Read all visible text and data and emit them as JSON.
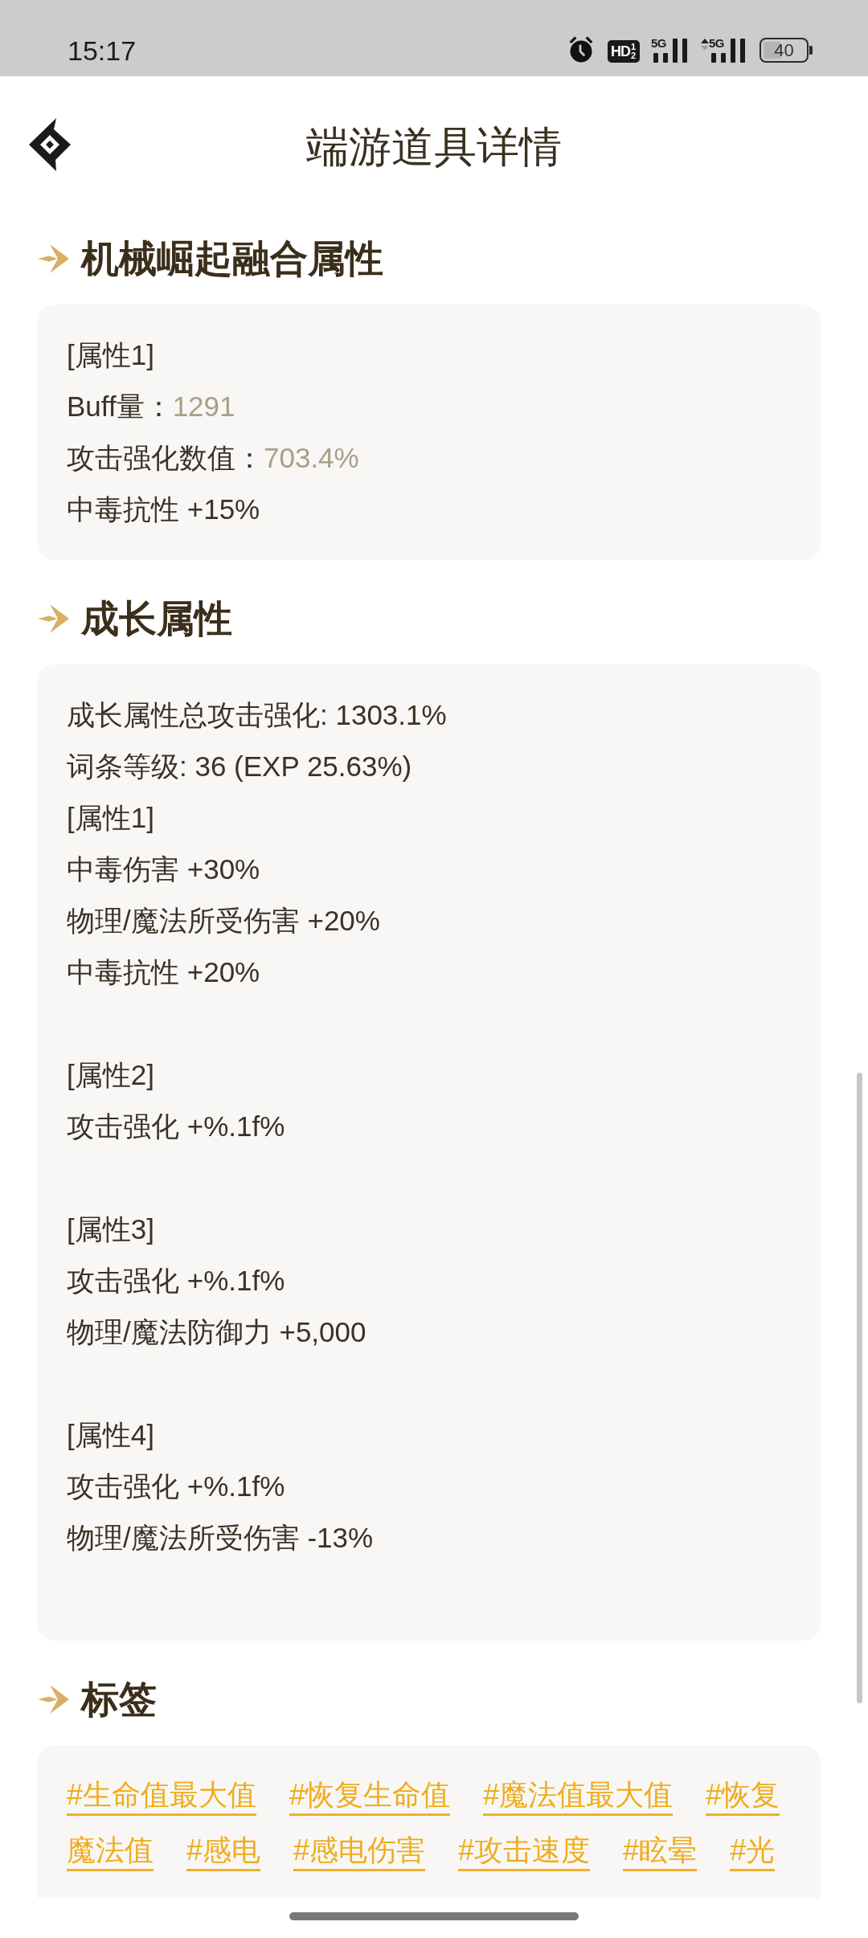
{
  "status_bar": {
    "time": "15:17",
    "hd_label": "HD",
    "hd_digits": [
      "1",
      "2"
    ],
    "signals": [
      {
        "label": "5G",
        "activity": false
      },
      {
        "label": "5G",
        "activity": true
      }
    ],
    "battery": "40"
  },
  "header": {
    "title": "端游道具详情"
  },
  "sections": [
    {
      "kind": "attributes",
      "title": "机械崛起融合属性",
      "lines": [
        {
          "kind": "plain",
          "text": "[属性1]"
        },
        {
          "kind": "stat",
          "label": "Buff量：",
          "value": "1291"
        },
        {
          "kind": "stat",
          "label": "攻击强化数值：",
          "value": "703.4%"
        },
        {
          "kind": "plain",
          "text": "中毒抗性 +15%"
        }
      ]
    },
    {
      "kind": "growth",
      "title": "成长属性",
      "summary": [
        "成长属性总攻击强化: 1303.1%",
        "词条等级: 36 (EXP 25.63%)"
      ],
      "groups": [
        {
          "title": "[属性1]",
          "lines": [
            "中毒伤害 +30%",
            "物理/魔法所受伤害 +20%",
            "中毒抗性 +20%"
          ]
        },
        {
          "title": "[属性2]",
          "lines": [
            "攻击强化 +%.1f%"
          ]
        },
        {
          "title": "[属性3]",
          "lines": [
            "攻击强化 +%.1f%",
            "物理/魔法防御力 +5,000"
          ]
        },
        {
          "title": "[属性4]",
          "lines": [
            "攻击强化 +%.1f%",
            "物理/魔法所受伤害 -13%"
          ]
        }
      ]
    },
    {
      "kind": "tags",
      "title": "标签",
      "tags": [
        "#生命值最大值",
        "#恢复生命值",
        "#魔法值最大值",
        "#恢复",
        "魔法值",
        "#感电",
        "#感电伤害",
        "#攻击速度",
        "#眩晕",
        "#光"
      ]
    }
  ]
}
